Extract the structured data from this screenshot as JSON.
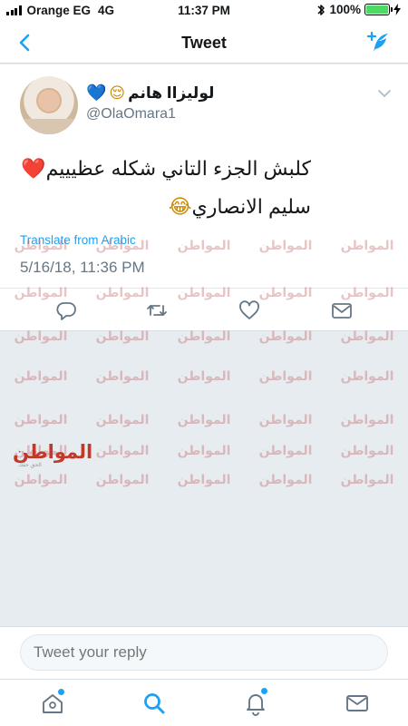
{
  "status_bar": {
    "carrier": "Orange EG",
    "network": "4G",
    "time": "11:37 PM",
    "battery": "100%",
    "battery_level": 1.0
  },
  "nav": {
    "title": "Tweet",
    "back_icon": "chevron-left-icon",
    "compose_icon": "compose-feather-icon"
  },
  "tweet": {
    "display_name": "لوليزاا هانم",
    "display_name_emojis": [
      "😌",
      "💙"
    ],
    "handle": "@OlaOmara1",
    "text_line1": "كلبش الجزء التاني شكله عظيييم",
    "text_line1_emoji": "❤️",
    "text_line2": "سليم الانصاري",
    "text_line2_emoji": "😂",
    "translate_label": "Translate from Arabic",
    "timestamp": "5/16/18, 11:36 PM"
  },
  "actions": [
    "reply-icon",
    "retweet-icon",
    "like-icon",
    "share-icon"
  ],
  "watermark": {
    "text": "المواطن",
    "logo_text": "المواطن",
    "logo_sub": "الحق حقك"
  },
  "reply": {
    "placeholder": "Tweet your reply"
  },
  "tab_bar": [
    "home-icon",
    "search-icon",
    "notifications-icon",
    "messages-icon"
  ],
  "colors": {
    "accent": "#1da1f2",
    "background": "#e6ecf0",
    "text_secondary": "#657786"
  }
}
